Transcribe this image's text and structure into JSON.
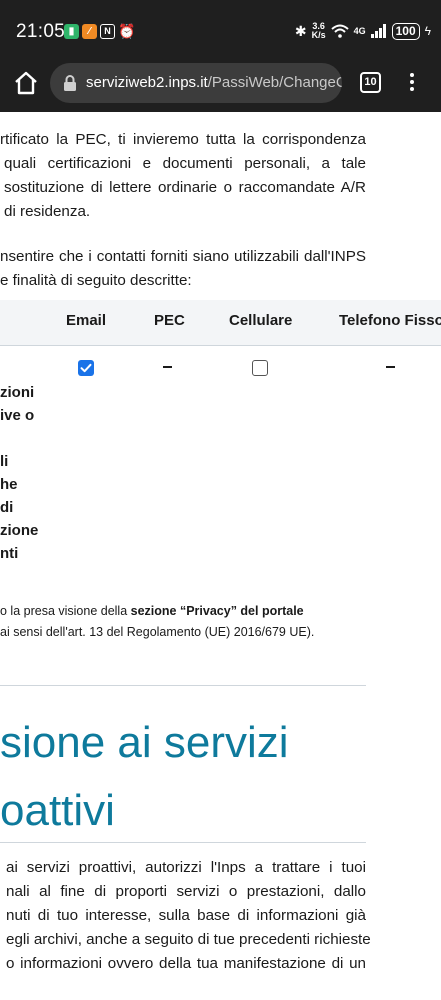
{
  "status_bar": {
    "time": "21:05",
    "app_icons": [
      "green-app-icon",
      "orange-app-icon",
      "nfc-icon",
      "alarm-icon"
    ],
    "speed_value": "3.6",
    "speed_unit": "K/s",
    "network": "4G",
    "battery": "100"
  },
  "browser": {
    "url_host": "serviziweb2.inps.it",
    "url_path": "/PassiWeb/ChangeCo",
    "tab_count": "10"
  },
  "intro": {
    "lines": [
      "rtificato la PEC, ti invieremo tutta la corrispondenza",
      "quali certificazioni e documenti personali, a tale",
      "sostituzione di lettere ordinarie o raccomandate A/R",
      "di residenza."
    ]
  },
  "consent": {
    "lines": [
      "nsentire che i contatti forniti siano utilizzabili dall'INPS",
      "e finalità di seguito descritte:"
    ]
  },
  "table": {
    "headers": [
      "Email",
      "PEC",
      "Cellulare",
      "Telefono Fisso"
    ],
    "row_label_lines": [
      "zioni",
      "ive o",
      "",
      "li",
      "he",
      "di",
      "zione",
      "nti"
    ],
    "email_checked": true,
    "cellulare_checked": false
  },
  "privacy_note": {
    "line1_prefix": "o la presa visione della ",
    "line1_bold": "sezione “Privacy” del portale",
    "line2": "ai sensi dell'art. 13 del Regolamento (UE) 2016/679 UE)."
  },
  "section": {
    "title_line1": "sione ai servizi",
    "title_line2": "oattivi",
    "lines": [
      "ai servizi proattivi, autorizzi l'Inps a trattare i tuoi",
      "nali al fine di proporti servizi o prestazioni, dallo",
      "nuti di tuo interesse, sulla base di informazioni già",
      "egli archivi, anche a seguito di tue precedenti richieste",
      "o informazioni ovvero della tua manifestazione di un"
    ]
  }
}
